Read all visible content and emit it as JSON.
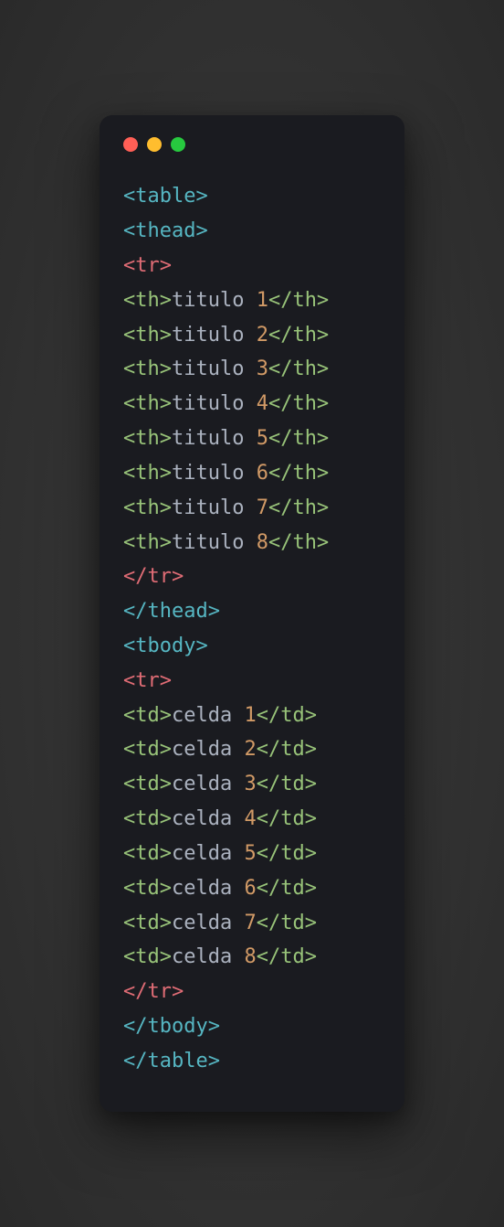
{
  "tags": {
    "table_open": "<table>",
    "thead_open": "<thead>",
    "tr_open": "<tr>",
    "th_open": "<th>",
    "th_close": "</th>",
    "tr_close": "</tr>",
    "thead_close": "</thead>",
    "tbody_open": "<tbody>",
    "td_open": "<td>",
    "td_close": "</td>",
    "tbody_close": "</tbody>",
    "table_close": "</table>"
  },
  "headers": [
    {
      "text": "titulo ",
      "num": "1"
    },
    {
      "text": "titulo ",
      "num": "2"
    },
    {
      "text": "titulo ",
      "num": "3"
    },
    {
      "text": "titulo ",
      "num": "4"
    },
    {
      "text": "titulo ",
      "num": "5"
    },
    {
      "text": "titulo ",
      "num": "6"
    },
    {
      "text": "titulo ",
      "num": "7"
    },
    {
      "text": "titulo ",
      "num": "8"
    }
  ],
  "cells": [
    {
      "text": "celda ",
      "num": "1"
    },
    {
      "text": "celda ",
      "num": "2"
    },
    {
      "text": "celda ",
      "num": "3"
    },
    {
      "text": "celda ",
      "num": "4"
    },
    {
      "text": "celda ",
      "num": "5"
    },
    {
      "text": "celda ",
      "num": "6"
    },
    {
      "text": "celda ",
      "num": "7"
    },
    {
      "text": "celda ",
      "num": "8"
    }
  ],
  "colors": {
    "red_dot": "#ff5f56",
    "yellow_dot": "#ffbd2e",
    "green_dot": "#27c93f",
    "bg": "#1a1b20",
    "tag_blue": "#56b6c2",
    "tag_red": "#e06c75",
    "tag_green": "#98c379",
    "text_white": "#abb2bf",
    "number_orange": "#d19a66"
  }
}
